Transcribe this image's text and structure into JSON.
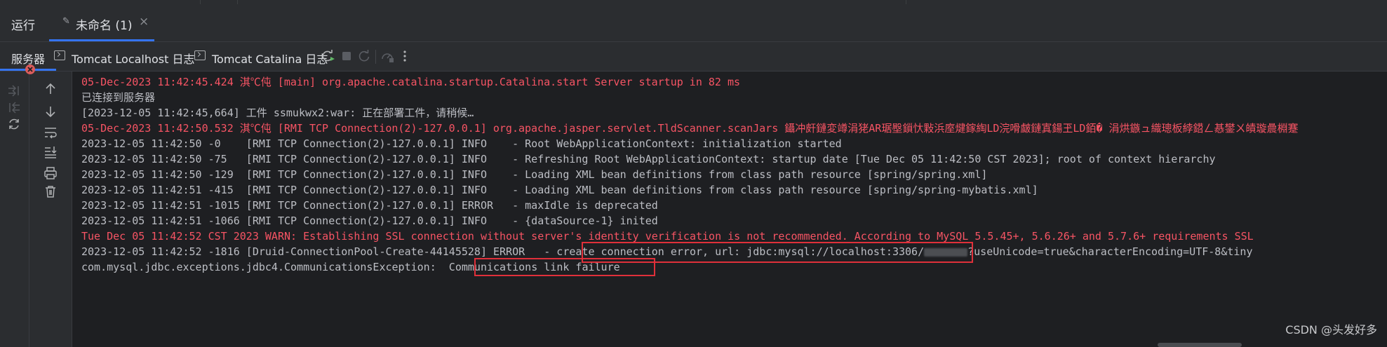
{
  "toolwindow": {
    "run_label": "运行",
    "active_tab_label": "未命名 (1)",
    "close_glyph": "×"
  },
  "subtabs": {
    "server_label": "服务器",
    "localhost_log_label": "Tomcat Localhost 日志",
    "catalina_log_label": "Tomcat Catalina 日志"
  },
  "toolbar_icons": [
    "rerun-icon",
    "stop-icon",
    "restart-icon",
    "update-app-icon",
    "more-icon"
  ],
  "colors": {
    "accent": "#3574f0",
    "error_text": "#f75464",
    "normal_text": "#bcbec4",
    "highlight_box": "#e0303a",
    "background": "#1e1f22",
    "panel": "#2b2d30"
  },
  "console": {
    "lines": [
      {
        "text": "05-Dec-2023 11:42:45.424 淇℃伅 [main] org.apache.catalina.startup.Catalina.start Server startup in 82 ms",
        "style": "red"
      },
      {
        "text": "已连接到服务器",
        "style": "normal"
      },
      {
        "text": "[2023-12-05 11:42:45,664] 工件 ssmukwx2:war: 正在部署工件，请稍候…",
        "style": "normal"
      },
      {
        "text": "05-Dec-2023 11:42:50.532 淇℃伅 [RMI TCP Connection(2)-127.0.0.1] org.apache.jasper.servlet.TldScanner.scanJars 鑷冲皯鏈変竴涓狫AR琚壂鎻忕敤浜庢煡鎵綯LD浣嗗皻鏈寘鍚玊LD銆� 涓烘鏃ュ織璁板綍鍣ㄥ惎鐢ㄨ皟璇曟棩蹇",
        "style": "red"
      },
      {
        "text": "2023-12-05 11:42:50 -0    [RMI TCP Connection(2)-127.0.0.1] INFO    - Root WebApplicationContext: initialization started",
        "style": "normal"
      },
      {
        "text": "2023-12-05 11:42:50 -75   [RMI TCP Connection(2)-127.0.0.1] INFO    - Refreshing Root WebApplicationContext: startup date [Tue Dec 05 11:42:50 CST 2023]; root of context hierarchy",
        "style": "normal"
      },
      {
        "text": "2023-12-05 11:42:50 -129  [RMI TCP Connection(2)-127.0.0.1] INFO    - Loading XML bean definitions from class path resource [spring/spring.xml]",
        "style": "normal"
      },
      {
        "text": "2023-12-05 11:42:51 -415  [RMI TCP Connection(2)-127.0.0.1] INFO    - Loading XML bean definitions from class path resource [spring/spring-mybatis.xml]",
        "style": "normal"
      },
      {
        "text": "2023-12-05 11:42:51 -1015 [RMI TCP Connection(2)-127.0.0.1] ERROR   - maxIdle is deprecated",
        "style": "normal"
      },
      {
        "text": "2023-12-05 11:42:51 -1066 [RMI TCP Connection(2)-127.0.0.1] INFO    - {dataSource-1} inited",
        "style": "normal"
      },
      {
        "text": "Tue Dec 05 11:42:52 CST 2023 WARN: Establishing SSL connection without server's identity verification is not recommended. According to MySQL 5.5.45+, 5.6.26+ and 5.7.6+ requirements SSL",
        "style": "red"
      }
    ],
    "error_line": {
      "prefix": "2023-12-05 11:42:52 -1816 [Druid-ConnectionPool-Create-44145528] ERROR  ",
      "highlighted": " - create connection error, url: jdbc:mysql://localhost:3306/",
      "suffix": "?useUnicode=true&characterEncoding=UTF-8&tiny"
    },
    "exception_line": {
      "prefix": "com.mysql.jdbc.exceptions.jdbc4.CommunicationsException: ",
      "highlighted": " Communications link failure  "
    }
  },
  "watermark": "CSDN @头发好多"
}
